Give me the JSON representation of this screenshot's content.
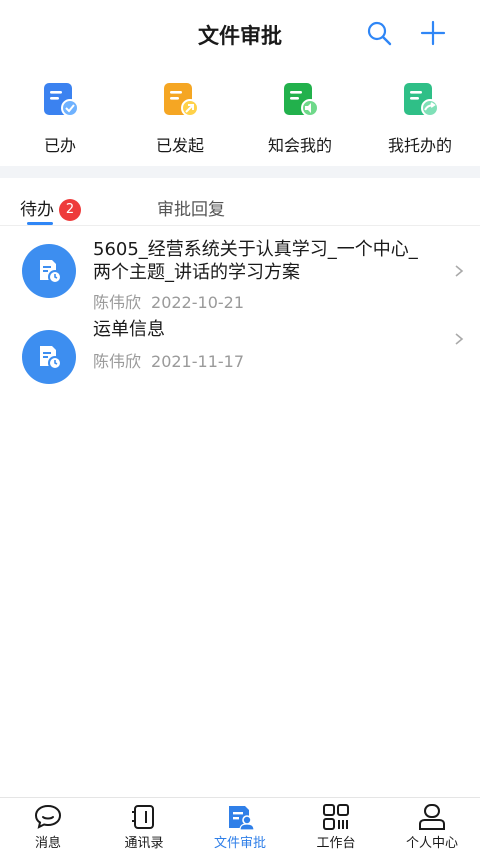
{
  "header": {
    "title": "文件审批",
    "search_icon": "search-icon",
    "add_icon": "plus-icon"
  },
  "quick_actions": [
    {
      "label": "已办",
      "icon": "done-doc-icon",
      "color": "#3b82f0"
    },
    {
      "label": "已发起",
      "icon": "initiated-doc-icon",
      "color": "#f5a623"
    },
    {
      "label": "知会我的",
      "icon": "notify-doc-icon",
      "color": "#22b14c"
    },
    {
      "label": "我托办的",
      "icon": "delegate-doc-icon",
      "color": "#2fbf87"
    }
  ],
  "tabs": [
    {
      "label": "待办",
      "badge": "2",
      "active": true
    },
    {
      "label": "审批回复",
      "active": false
    }
  ],
  "items": [
    {
      "title": "5605_经营系统关于认真学习_一个中心_两个主题_讲话的学习方案",
      "author": "陈伟欣",
      "date": "2022-10-21",
      "icon": "document-clock-icon"
    },
    {
      "title": "运单信息",
      "author": "陈伟欣",
      "date": "2021-11-17",
      "icon": "document-clock-icon"
    }
  ],
  "bottom_nav": [
    {
      "label": "消息",
      "icon": "chat-icon",
      "active": false
    },
    {
      "label": "通讯录",
      "icon": "contacts-icon",
      "active": false
    },
    {
      "label": "文件审批",
      "icon": "approval-icon",
      "active": true
    },
    {
      "label": "工作台",
      "icon": "workbench-icon",
      "active": false
    },
    {
      "label": "个人中心",
      "icon": "profile-icon",
      "active": false
    }
  ],
  "colors": {
    "accent": "#2f86f6",
    "badge": "#ee3b3b",
    "muted_text": "#9a9a9a"
  }
}
